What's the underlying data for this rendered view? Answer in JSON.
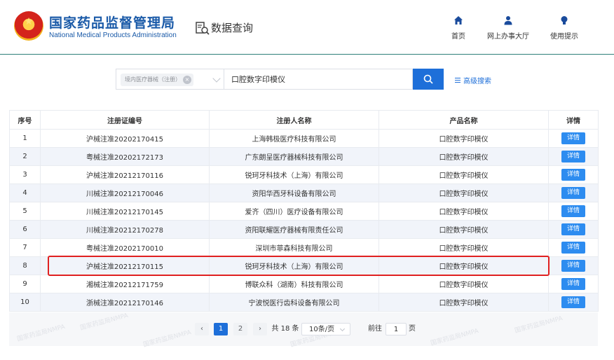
{
  "header": {
    "org_name_cn": "国家药品监督管理局",
    "org_name_en": "National Medical Products Administration",
    "section_title": "数据查询",
    "nav": [
      {
        "label": "首页",
        "icon": "home-icon"
      },
      {
        "label": "网上办事大厅",
        "icon": "user-icon"
      },
      {
        "label": "使用提示",
        "icon": "lightbulb-icon"
      }
    ]
  },
  "search": {
    "category_tag": "境内医疗器械（注册）",
    "query": "口腔数字印模仪",
    "advanced_label": "高级搜索"
  },
  "table": {
    "headers": [
      "序号",
      "注册证编号",
      "注册人名称",
      "产品名称",
      "详情"
    ],
    "detail_label": "详情",
    "rows": [
      {
        "no": "1",
        "reg": "沪械注准20202170415",
        "company": "上海韩极医疗科技有限公司",
        "product": "口腔数字印模仪"
      },
      {
        "no": "2",
        "reg": "粤械注准20202172173",
        "company": "广东朗呈医疗器械科技有限公司",
        "product": "口腔数字印模仪"
      },
      {
        "no": "3",
        "reg": "沪械注准20212170116",
        "company": "锐珂牙科技术（上海）有限公司",
        "product": "口腔数字印模仪"
      },
      {
        "no": "4",
        "reg": "川械注准20212170046",
        "company": "资阳华西牙科设备有限公司",
        "product": "口腔数字印模仪"
      },
      {
        "no": "5",
        "reg": "川械注准20212170145",
        "company": "爱齐（四川）医疗设备有限公司",
        "product": "口腔数字印模仪"
      },
      {
        "no": "6",
        "reg": "川械注准20212170278",
        "company": "资阳联耀医疗器械有限责任公司",
        "product": "口腔数字印模仪"
      },
      {
        "no": "7",
        "reg": "粤械注准20202170010",
        "company": "深圳市菲森科技有限公司",
        "product": "口腔数字印模仪"
      },
      {
        "no": "8",
        "reg": "沪械注准20212170115",
        "company": "锐珂牙科技术（上海）有限公司",
        "product": "口腔数字印模仪"
      },
      {
        "no": "9",
        "reg": "湘械注准20212171759",
        "company": "博联众科（湖南）科技有限公司",
        "product": "口腔数字印模仪"
      },
      {
        "no": "10",
        "reg": "浙械注准20212170146",
        "company": "宁波悦医行齿科设备有限公司",
        "product": "口腔数字印模仪"
      }
    ]
  },
  "pagination": {
    "prev": "‹",
    "page1": "1",
    "page2": "2",
    "next": "›",
    "total": "共 18 条",
    "page_size": "10条/页",
    "goto_label": "前往",
    "goto_value": "1",
    "page_unit": "页"
  },
  "colors": {
    "brand_blue": "#1a5aa8",
    "primary": "#1e6fd9",
    "highlight_red": "#e02020"
  }
}
